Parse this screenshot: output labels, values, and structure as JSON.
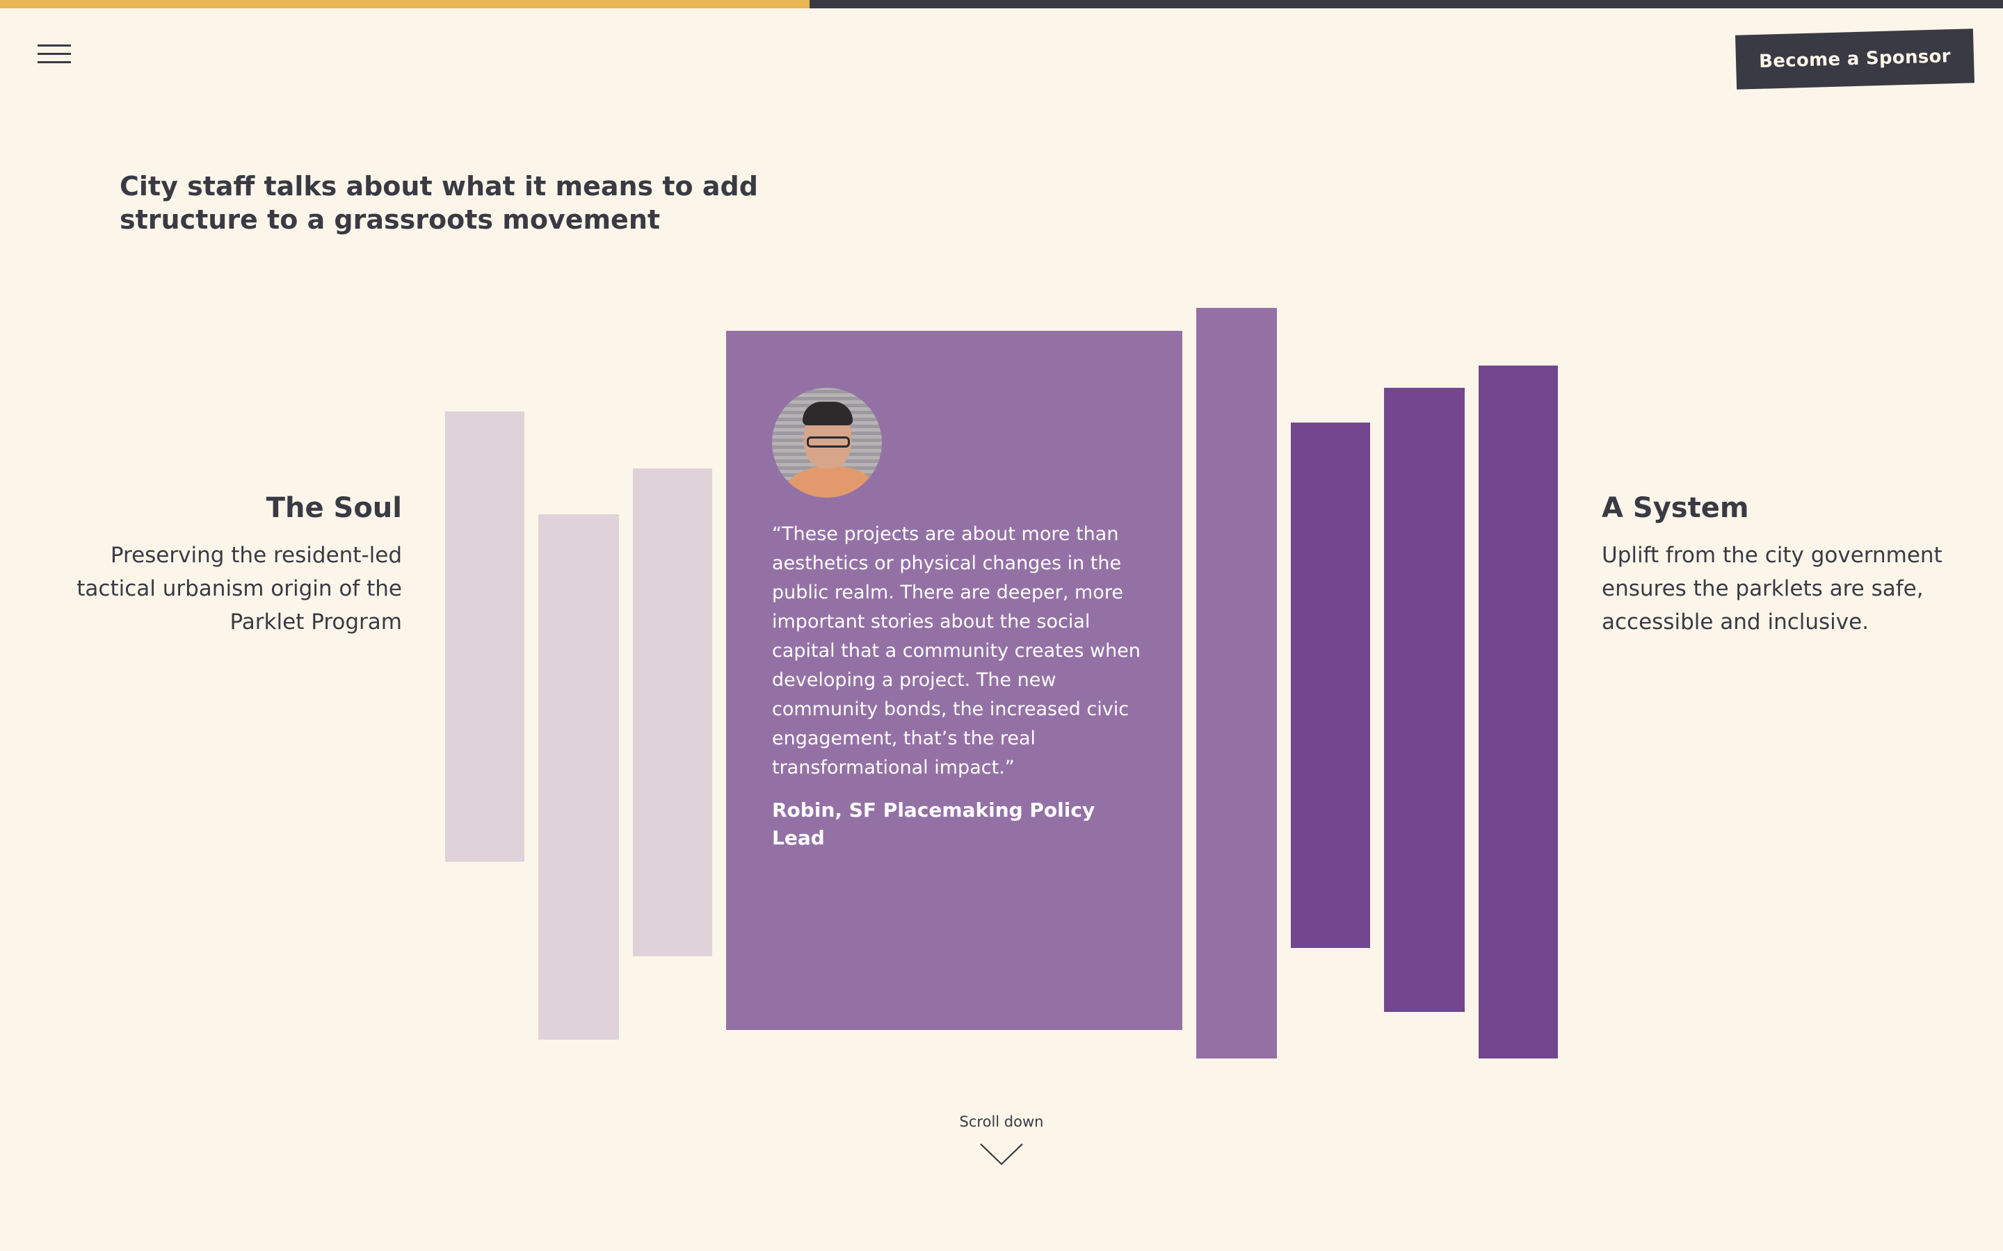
{
  "progress": {
    "fraction": 0.404,
    "fill_color": "#e8b654",
    "track_color": "#3a3a44"
  },
  "nav": {
    "menu_icon": "hamburger-menu-icon",
    "sponsor_label": "Become a Sponsor"
  },
  "headline": "City staff talks about what it means to add structure to a grassroots movement",
  "left_panel": {
    "title": "The Soul",
    "text": "Preserving the resident-led tactical urbanism origin of the Parklet Program"
  },
  "right_panel": {
    "title": "A System",
    "text": "Uplift from the city government ensures the parklets are safe, accessible and inclusive."
  },
  "quote": {
    "text": "“These projects are about more than aesthetics or physical changes in the public realm. There are deeper, more important stories about the social capital that a community creates when developing a project. The new community bonds, the increased civic engagement, that’s the real transformational impact.”",
    "author": "Robin, SF Placemaking Policy Lead",
    "avatar_icon": "person-portrait"
  },
  "scroll": {
    "label": "Scroll down",
    "icon": "chevron-down-icon"
  },
  "colors": {
    "background": "#fcf6ea",
    "text": "#3a3a44",
    "bar_light": "#e0d2d9",
    "bar_mid": "#9471a5",
    "bar_dark": "#72478e"
  }
}
